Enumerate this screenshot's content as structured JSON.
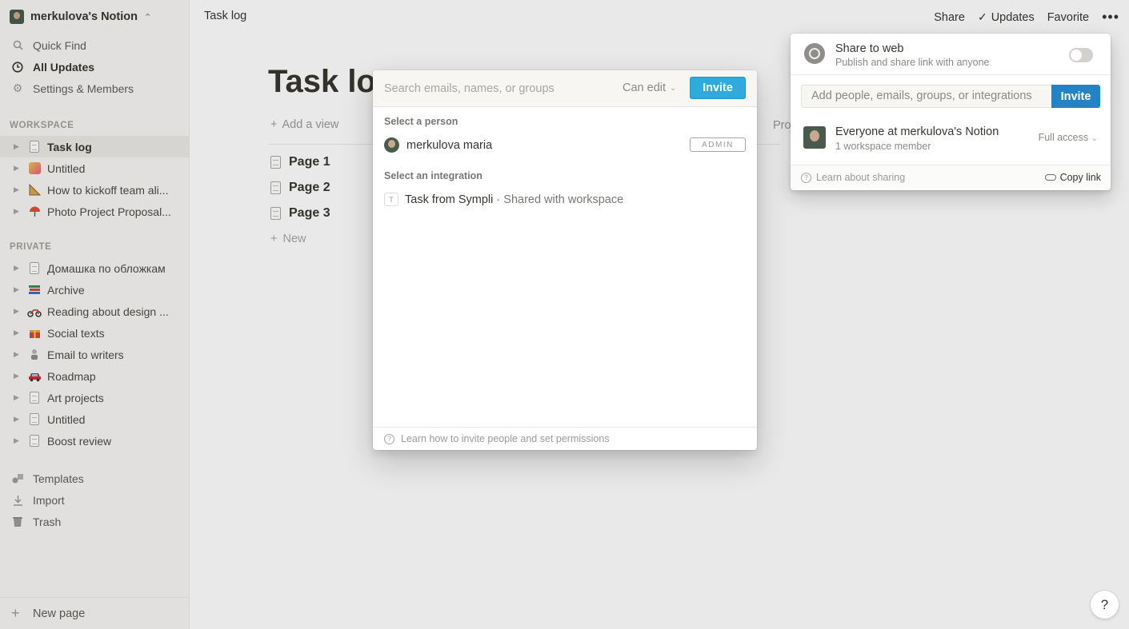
{
  "workspace": {
    "name": "merkulova's Notion"
  },
  "sidebar": {
    "top_items": [
      {
        "label": "Quick Find",
        "icon": "search-icon"
      },
      {
        "label": "All Updates",
        "icon": "clock-icon"
      },
      {
        "label": "Settings & Members",
        "icon": "gear-icon"
      }
    ],
    "workspace_label": "WORKSPACE",
    "workspace_pages": [
      {
        "label": "Task log",
        "icon": "page-icon"
      },
      {
        "label": "Untitled",
        "icon": "party-popper-icon"
      },
      {
        "label": "How to kickoff team ali...",
        "icon": "triangular-ruler-icon"
      },
      {
        "label": "Photo Project Proposal...",
        "icon": "umbrella-icon"
      }
    ],
    "private_label": "PRIVATE",
    "private_pages": [
      {
        "label": "Домашка по обложкам",
        "icon": "page-icon"
      },
      {
        "label": "Archive",
        "icon": "books-icon"
      },
      {
        "label": "Reading about design ...",
        "icon": "motorcycle-icon"
      },
      {
        "label": "Social texts",
        "icon": "gift-icon"
      },
      {
        "label": "Email to writers",
        "icon": "gear-person-icon"
      },
      {
        "label": "Roadmap",
        "icon": "car-icon"
      },
      {
        "label": "Art projects",
        "icon": "page-icon"
      },
      {
        "label": "Untitled",
        "icon": "page-icon"
      },
      {
        "label": "Boost review",
        "icon": "page-icon"
      }
    ],
    "bottom_items": [
      {
        "label": "Templates",
        "icon": "shapes-icon"
      },
      {
        "label": "Import",
        "icon": "download-icon"
      },
      {
        "label": "Trash",
        "icon": "trash-icon"
      }
    ],
    "new_page_label": "New page"
  },
  "topbar": {
    "breadcrumb": "Task log",
    "share": "Share",
    "updates": "Updates",
    "favorite": "Favorite",
    "more": "•••"
  },
  "page": {
    "title": "Task lo",
    "add_view": "Add a view",
    "property_hint": "Pro",
    "rows": [
      "Page 1",
      "Page 2",
      "Page 3"
    ],
    "new_label": "New"
  },
  "share_popover": {
    "share_to_web_title": "Share to web",
    "share_to_web_subtitle": "Publish and share link with anyone",
    "add_people_placeholder": "Add people, emails, groups, or integrations",
    "invite": "Invite",
    "everyone_name": "Everyone at merkulova's Notion",
    "everyone_count": "1 workspace member",
    "access_level": "Full access",
    "learn": "Learn about sharing",
    "copy_link": "Copy link"
  },
  "invite_modal": {
    "search_placeholder": "Search emails, names, or groups",
    "permission": "Can edit",
    "invite": "Invite",
    "select_person_label": "Select a person",
    "person_name": "merkulova maria",
    "person_badge": "ADMIN",
    "select_integration_label": "Select an integration",
    "integration_letter": "T",
    "integration_name": "Task from Sympli",
    "integration_detail": " · Shared with workspace",
    "learn": "Learn how to invite people and set permissions"
  },
  "help": "?",
  "colors": {
    "accent": "#2eaadc",
    "invite_dark": "#2383c4",
    "sidebar_bg": "#f7f6f3"
  }
}
